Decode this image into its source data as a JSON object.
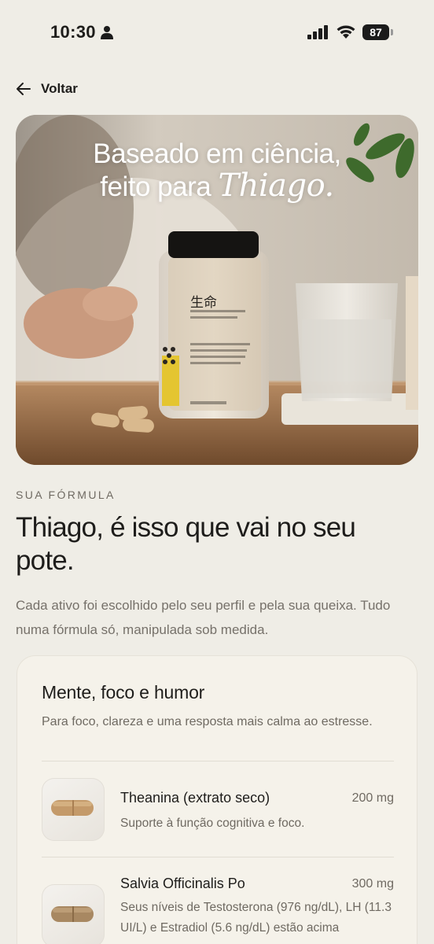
{
  "status_bar": {
    "time": "10:30",
    "battery": "87"
  },
  "nav": {
    "back_label": "Voltar"
  },
  "hero": {
    "title_line1": "Baseado em ciência,",
    "title_line2_prefix": "feito para ",
    "title_name": "Thiago.",
    "jar_label": "生命"
  },
  "section": {
    "eyebrow": "SUA FÓRMULA",
    "headline": "Thiago, é isso que vai no seu pote.",
    "intro": "Cada ativo foi escolhido pelo seu perfil e pela sua queixa. Tudo numa fórmula só, manipulada sob medida."
  },
  "card": {
    "title": "Mente, foco e humor",
    "description": "Para foco, clareza e uma resposta mais calma ao estresse.",
    "ingredients": [
      {
        "name": "Theanina (extrato seco)",
        "dose": "200 mg",
        "description": "Suporte à função cognitiva e foco."
      },
      {
        "name": "Salvia Officinalis Po",
        "dose": "300 mg",
        "description": "Seus níveis de Testosterona (976 ng/dL), LH (11.3 UI/L) e Estradiol (5.6 ng/dL) estão acima"
      }
    ]
  },
  "colors": {
    "background": "#efede6",
    "card": "#f5f2ea",
    "text_primary": "#1e1d1b",
    "text_secondary": "#6f6a62"
  }
}
